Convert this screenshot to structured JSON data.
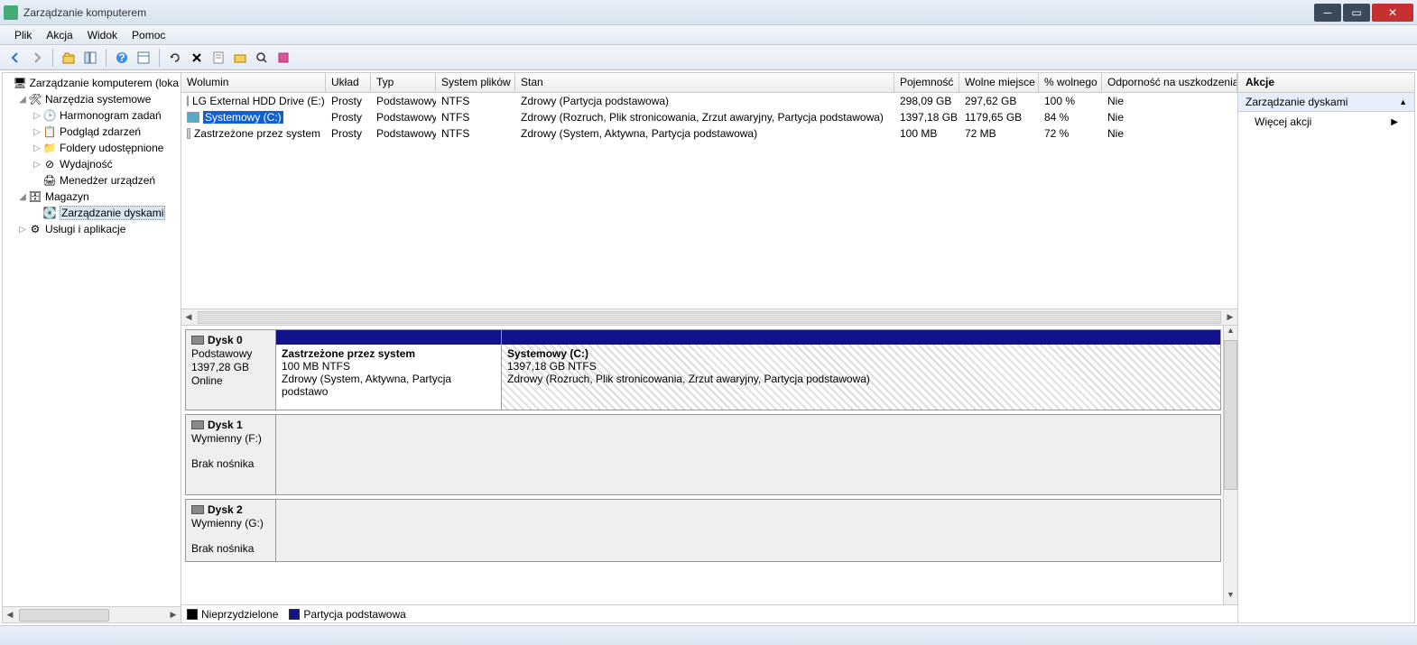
{
  "window": {
    "title": "Zarządzanie komputerem"
  },
  "menu": {
    "file": "Plik",
    "action": "Akcja",
    "view": "Widok",
    "help": "Pomoc"
  },
  "tree": {
    "root": "Zarządzanie komputerem (loka",
    "tools": "Narzędzia systemowe",
    "scheduler": "Harmonogram zadań",
    "events": "Podgląd zdarzeń",
    "shared": "Foldery udostępnione",
    "perf": "Wydajność",
    "devmgr": "Menedżer urządzeń",
    "storage": "Magazyn",
    "diskmgmt": "Zarządzanie dyskami",
    "services": "Usługi i aplikacje"
  },
  "cols": {
    "volume": "Wolumin",
    "layout": "Układ",
    "type": "Typ",
    "fs": "System plików",
    "status": "Stan",
    "capacity": "Pojemność",
    "free": "Wolne miejsce",
    "pct": "% wolnego",
    "fault": "Odporność na uszkodzenia"
  },
  "rows": [
    {
      "name": "LG External HDD Drive (E:)",
      "layout": "Prosty",
      "type": "Podstawowy",
      "fs": "NTFS",
      "status": "Zdrowy (Partycja podstawowa)",
      "cap": "298,09 GB",
      "free": "297,62 GB",
      "pct": "100 %",
      "fault": "Nie"
    },
    {
      "name": "Systemowy (C:)",
      "layout": "Prosty",
      "type": "Podstawowy",
      "fs": "NTFS",
      "status": "Zdrowy (Rozruch, Plik stronicowania, Zrzut awaryjny, Partycja podstawowa)",
      "cap": "1397,18 GB",
      "free": "1179,65 GB",
      "pct": "84 %",
      "fault": "Nie"
    },
    {
      "name": "Zastrzeżone przez system",
      "layout": "Prosty",
      "type": "Podstawowy",
      "fs": "NTFS",
      "status": "Zdrowy (System, Aktywna, Partycja podstawowa)",
      "cap": "100 MB",
      "free": "72 MB",
      "pct": "72 %",
      "fault": "Nie"
    }
  ],
  "disks": {
    "d0": {
      "title": "Dysk 0",
      "type": "Podstawowy",
      "size": "1397,28 GB",
      "state": "Online",
      "p0": {
        "name": "Zastrzeżone przez system",
        "size": "100 MB NTFS",
        "status": "Zdrowy (System, Aktywna, Partycja podstawo"
      },
      "p1": {
        "name": "Systemowy  (C:)",
        "size": "1397,18 GB NTFS",
        "status": "Zdrowy (Rozruch, Plik stronicowania, Zrzut awaryjny, Partycja podstawowa)"
      }
    },
    "d1": {
      "title": "Dysk 1",
      "type": "Wymienny (F:)",
      "state": "Brak nośnika"
    },
    "d2": {
      "title": "Dysk 2",
      "type": "Wymienny (G:)",
      "state": "Brak nośnika"
    }
  },
  "legend": {
    "unalloc": "Nieprzydzielone",
    "primary": "Partycja podstawowa"
  },
  "actions": {
    "header": "Akcje",
    "section": "Zarządzanie dyskami",
    "more": "Więcej akcji"
  }
}
